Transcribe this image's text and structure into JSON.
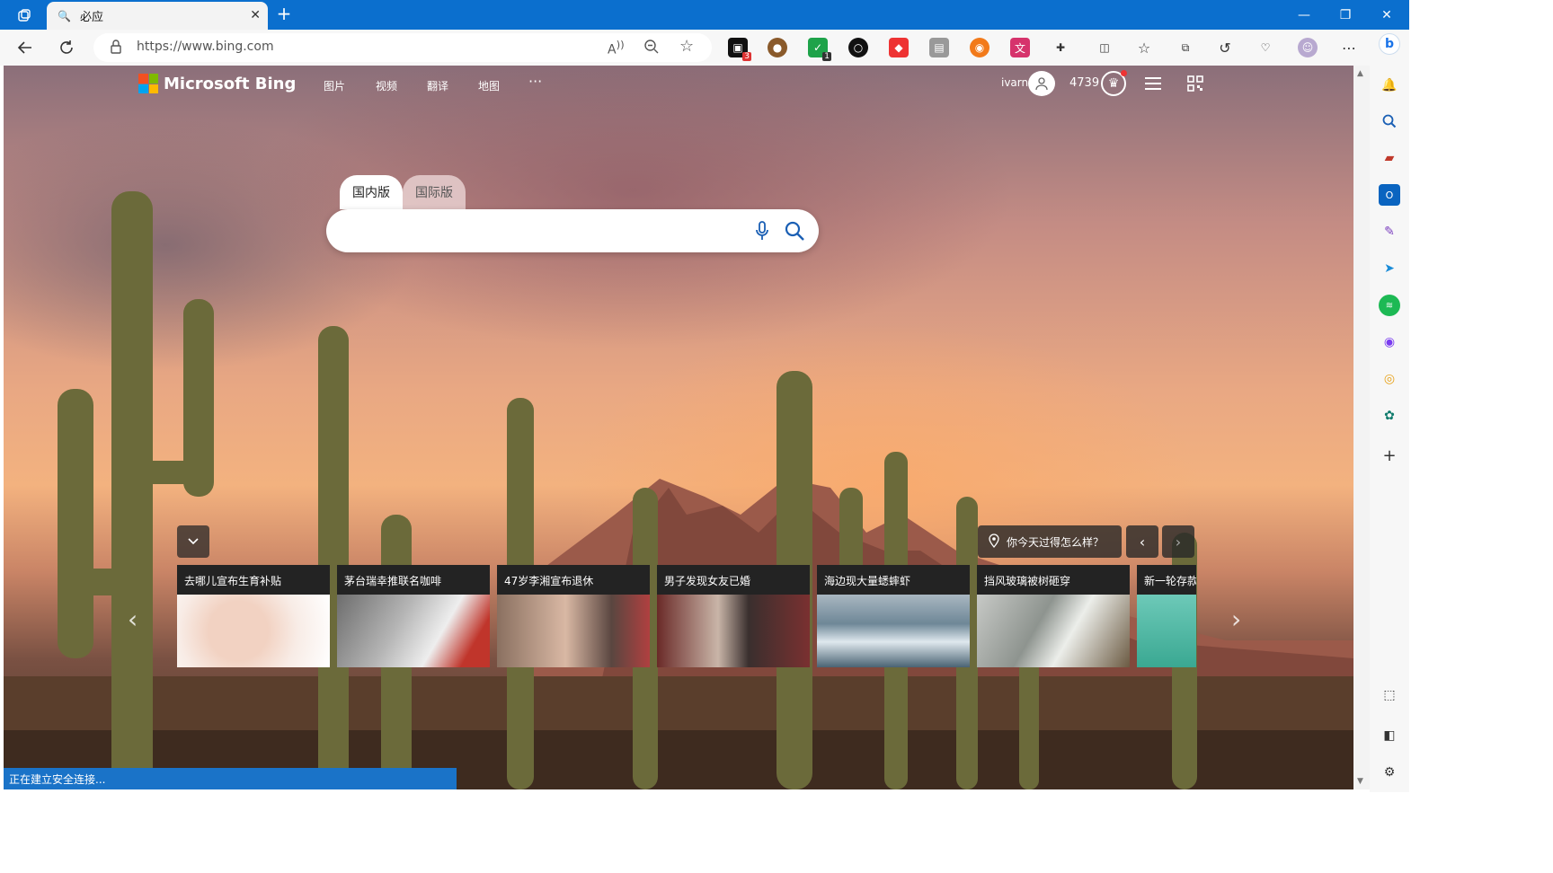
{
  "browser": {
    "tab_title": "必应",
    "url": "https://www.bing.com",
    "status_text": "正在建立安全连接..."
  },
  "extensions": [
    "bookmark-ext",
    "cookie-ext",
    "shield-ext",
    "circle-ext",
    "red-ext",
    "reader-ext",
    "orange-ext",
    "pink-ext",
    "puzzle-ext"
  ],
  "extension_badges": {
    "bookmark": "3",
    "shield": "1"
  },
  "bing": {
    "logo_text": "Microsoft Bing",
    "nav": [
      "图片",
      "视频",
      "翻译",
      "地图"
    ],
    "more": "···",
    "username": "ivarn",
    "points": "4739",
    "search_tabs": {
      "domestic": "国内版",
      "international": "国际版"
    },
    "how_day": "你今天过得怎么样？",
    "news": [
      {
        "title": "去哪儿宣布生育补贴"
      },
      {
        "title": "茅台瑞幸推联名咖啡"
      },
      {
        "title": "47岁李湘宣布退休"
      },
      {
        "title": "男子发现女友已婚"
      },
      {
        "title": "海边现大量蟋蟀虾"
      },
      {
        "title": "挡风玻璃被树砸穿"
      },
      {
        "title": "新一轮存款"
      }
    ]
  },
  "colors": {
    "titlebar": "#0b6fce",
    "status": "#1a73c8"
  }
}
